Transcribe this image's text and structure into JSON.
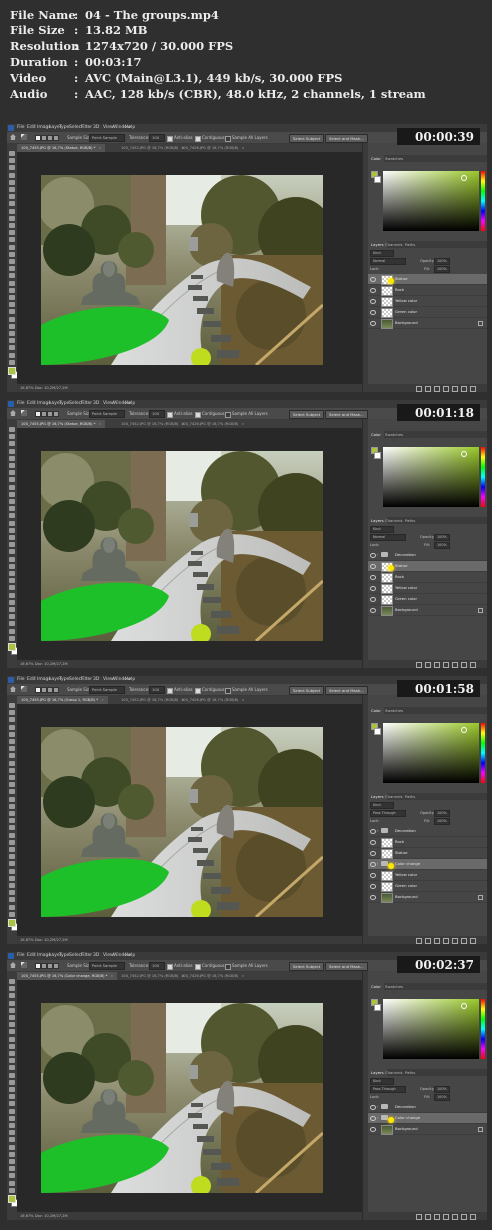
{
  "info": [
    {
      "key": "File Name",
      "value": "04 - The groups.mp4"
    },
    {
      "key": "File Size",
      "value": "13.82 MB"
    },
    {
      "key": "Resolution",
      "value": "1274x720 / 30.000 FPS"
    },
    {
      "key": "Duration",
      "value": "00:03:17"
    },
    {
      "key": "Video",
      "value": "AVC (Main@L3.1), 449 kb/s, 30.000 FPS"
    },
    {
      "key": "Audio",
      "value": "AAC, 128 kb/s (CBR), 48.0 kHz, 2 channels, 1 stream"
    }
  ],
  "menu": [
    "File",
    "Edit",
    "Image",
    "Layer",
    "Type",
    "Select",
    "Filter",
    "3D",
    "View",
    "Window",
    "Help"
  ],
  "options": {
    "sample_size_label": "Sample Size:",
    "sample_size_value": "Point Sample",
    "tolerance_label": "Tolerance:",
    "tolerance_value": "100",
    "anti_alias": "Anti-alias",
    "contiguous": "Contiguous",
    "sample_all": "Sample All Layers",
    "select_subject": "Select Subject",
    "select_mask": "Select and Mask..."
  },
  "panels": {
    "color_tab": "Color",
    "swatches_tab": "Swatches",
    "layers_tab": "Layers",
    "channels_tab": "Channels",
    "paths_tab": "Paths",
    "kind": "Kind",
    "opacity_label": "Opacity:",
    "opacity_value": "100%",
    "fill_label": "Fill:",
    "fill_value": "100%",
    "lock_label": "Lock:"
  },
  "colors": {
    "foreground": "#a9c33d",
    "accent_picker": "#9ac82a",
    "timecode_bg": "#191919"
  },
  "frames": [
    {
      "timecode": "00:00:39",
      "tabs": [
        "100_7455.JPG @ 16,7% (Statue, RGB/8) *",
        "100_7452.JPG @ 16,7% (RGB/8)",
        "100_7426.JPG @ 16,7% (RGB/8)"
      ],
      "status": "16,67%   Doc: 10,2M/27,2M",
      "blend_mode": "Normal",
      "layers": [
        {
          "name": "Statue",
          "type": "layer",
          "selected": true
        },
        {
          "name": "Rock",
          "type": "layer",
          "selected": false
        },
        {
          "name": "Yellow color",
          "type": "layer",
          "selected": false
        },
        {
          "name": "Green color",
          "type": "layer",
          "selected": false
        },
        {
          "name": "Background",
          "type": "background",
          "selected": false
        }
      ]
    },
    {
      "timecode": "00:01:18",
      "tabs": [
        "100_7455.JPG @ 16,7% (Statue, RGB/8) *",
        "100_7452.JPG @ 16,7% (RGB/8)",
        "100_7426.JPG @ 16,7% (RGB/8)"
      ],
      "status": "16,67%   Doc: 10,2M/27,2M",
      "blend_mode": "Normal",
      "layers": [
        {
          "name": "Decoration",
          "type": "group",
          "selected": false
        },
        {
          "name": "Statue",
          "type": "layer",
          "selected": true
        },
        {
          "name": "Rock",
          "type": "layer",
          "selected": false
        },
        {
          "name": "Yellow color",
          "type": "layer",
          "selected": false
        },
        {
          "name": "Green color",
          "type": "layer",
          "selected": false
        },
        {
          "name": "Background",
          "type": "background",
          "selected": false
        }
      ]
    },
    {
      "timecode": "00:01:58",
      "tabs": [
        "100_7455.JPG @ 16,7% (Group 1, RGB/8) *",
        "100_7452.JPG @ 16,7% (RGB/8)",
        "100_7426.JPG @ 16,7% (RGB/8)"
      ],
      "status": "16,67%   Doc: 10,2M/27,2M",
      "blend_mode": "Pass Through",
      "layers": [
        {
          "name": "Decoration",
          "type": "group",
          "selected": false
        },
        {
          "name": "Rock",
          "type": "layer",
          "selected": false
        },
        {
          "name": "Statue",
          "type": "layer",
          "selected": false
        },
        {
          "name": "Color change",
          "type": "group",
          "selected": true
        },
        {
          "name": "Yellow color",
          "type": "layer",
          "selected": false
        },
        {
          "name": "Green color",
          "type": "layer",
          "selected": false
        },
        {
          "name": "Background",
          "type": "background",
          "selected": false
        }
      ]
    },
    {
      "timecode": "00:02:37",
      "tabs": [
        "100_7455.JPG @ 16,7% (Color change, RGB/8) *",
        "100_7452.JPG @ 16,7% (RGB/8)",
        "100_7426.JPG @ 16,7% (RGB/8)"
      ],
      "status": "16,67%   Doc: 10,2M/27,2M",
      "blend_mode": "Pass Through",
      "layers": [
        {
          "name": "Decoration",
          "type": "group",
          "selected": false
        },
        {
          "name": "Color change",
          "type": "group",
          "selected": true
        },
        {
          "name": "Background",
          "type": "background",
          "selected": false
        }
      ]
    }
  ]
}
